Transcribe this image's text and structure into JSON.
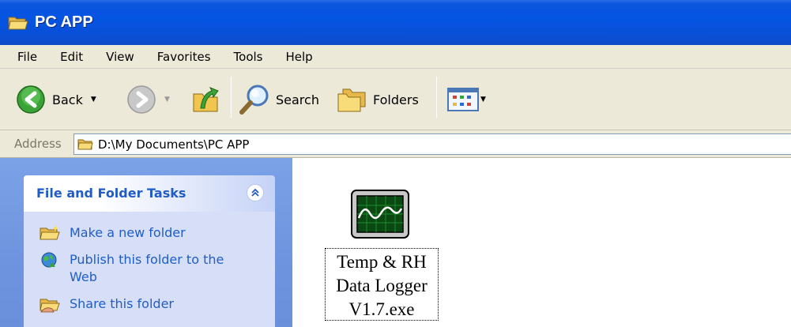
{
  "window": {
    "title": "PC APP",
    "folder_icon": "folder-open-icon",
    "title_color": "#ffffff",
    "titlebar_color": "#0554e3"
  },
  "menu": {
    "items": [
      {
        "label": "File"
      },
      {
        "label": "Edit"
      },
      {
        "label": "View"
      },
      {
        "label": "Favorites"
      },
      {
        "label": "Tools"
      },
      {
        "label": "Help"
      }
    ]
  },
  "toolbar": {
    "back_label": "Back",
    "search_label": "Search",
    "folders_label": "Folders",
    "icons": {
      "back": "back-arrow-icon",
      "forward": "forward-arrow-icon",
      "up": "up-folder-icon",
      "search": "search-icon",
      "folders": "folders-icon",
      "views": "views-icon"
    }
  },
  "address": {
    "label": "Address",
    "path": "D:\\My Documents\\PC APP"
  },
  "tasks": {
    "title": "File and Folder Tasks",
    "links": [
      {
        "label": "Make a new folder",
        "icon": "new-folder-icon"
      },
      {
        "label": "Publish this folder to the Web",
        "icon": "publish-web-icon"
      },
      {
        "label": "Share this folder",
        "icon": "share-folder-icon"
      }
    ],
    "link_color": "#215dc6",
    "pane_color": "#7ba2e7"
  },
  "files": [
    {
      "name_lines": [
        "Temp & RH",
        "Data Logger",
        "V1.7.exe"
      ],
      "icon": "waveform-monitor-icon"
    }
  ]
}
